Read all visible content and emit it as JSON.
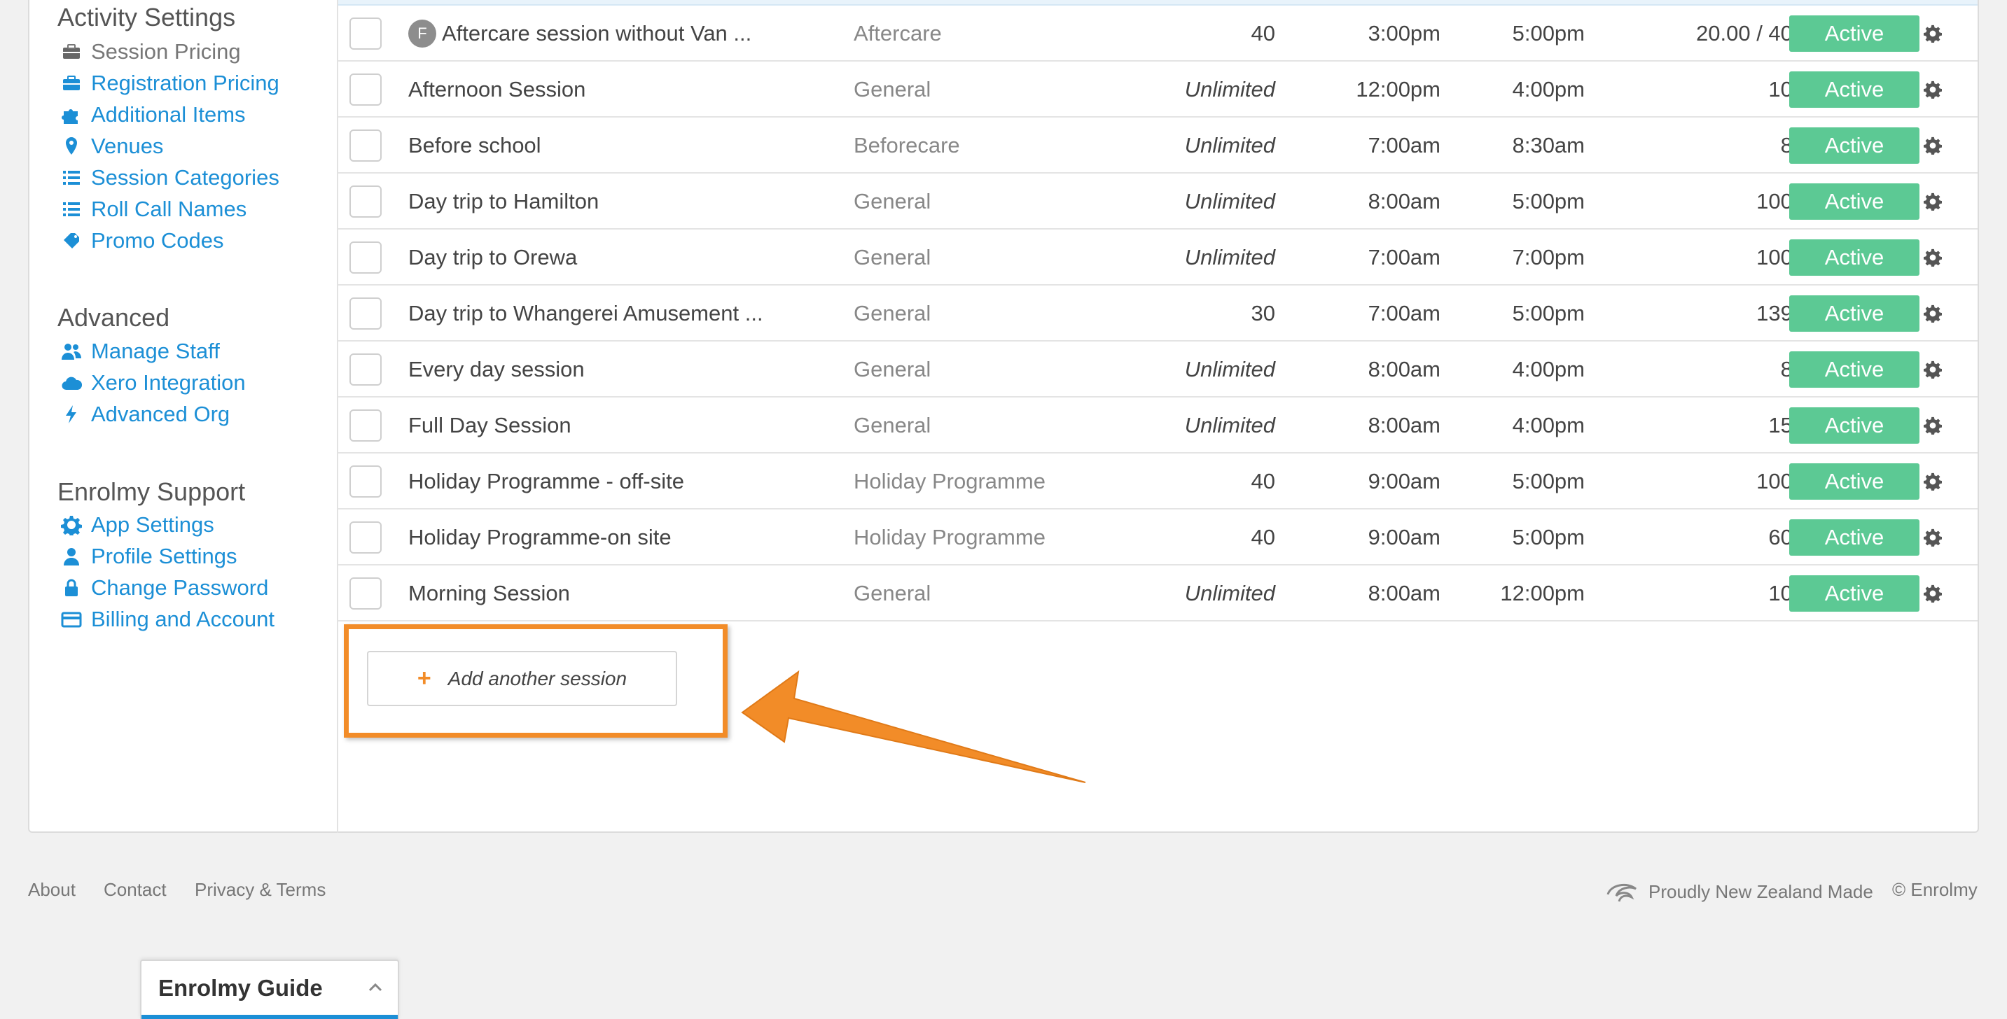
{
  "sidebar": {
    "activity_heading": "Activity Settings",
    "activity_items": [
      {
        "label": "Session Pricing",
        "icon": "briefcase-icon",
        "active": true
      },
      {
        "label": "Registration Pricing",
        "icon": "briefcase-icon"
      },
      {
        "label": "Additional Items",
        "icon": "puzzle-icon"
      },
      {
        "label": "Venues",
        "icon": "map-marker-icon"
      },
      {
        "label": "Session Categories",
        "icon": "list-icon"
      },
      {
        "label": "Roll Call Names",
        "icon": "list-icon"
      },
      {
        "label": "Promo Codes",
        "icon": "ticket-icon"
      }
    ],
    "advanced_heading": "Advanced",
    "advanced_items": [
      {
        "label": "Manage Staff",
        "icon": "users-icon"
      },
      {
        "label": "Xero Integration",
        "icon": "cloud-icon"
      },
      {
        "label": "Advanced Org",
        "icon": "bolt-icon"
      }
    ],
    "support_heading": "Enrolmy Support",
    "support_items": [
      {
        "label": "App Settings",
        "icon": "gear-icon"
      },
      {
        "label": "Profile Settings",
        "icon": "user-icon"
      },
      {
        "label": "Change Password",
        "icon": "lock-icon"
      },
      {
        "label": "Billing and Account",
        "icon": "credit-card-icon"
      }
    ]
  },
  "sessions": [
    {
      "flag": "F",
      "name": "Aftercare session without Van ...",
      "category": "Aftercare",
      "capacity": "40",
      "start": "3:00pm",
      "end": "5:00pm",
      "price": "20.00  / 40.00",
      "status": "Active"
    },
    {
      "flag": "",
      "name": "Afternoon Session",
      "category": "General",
      "capacity": "Unlimited",
      "start": "12:00pm",
      "end": "4:00pm",
      "price": "10.00",
      "status": "Active"
    },
    {
      "flag": "",
      "name": "Before school",
      "category": "Beforecare",
      "capacity": "Unlimited",
      "start": "7:00am",
      "end": "8:30am",
      "price": "8.00",
      "status": "Active"
    },
    {
      "flag": "",
      "name": "Day trip to Hamilton",
      "category": "General",
      "capacity": "Unlimited",
      "start": "8:00am",
      "end": "5:00pm",
      "price": "100.00",
      "status": "Active"
    },
    {
      "flag": "",
      "name": "Day trip to Orewa",
      "category": "General",
      "capacity": "Unlimited",
      "start": "7:00am",
      "end": "7:00pm",
      "price": "100.00",
      "status": "Active"
    },
    {
      "flag": "",
      "name": "Day trip to Whangerei Amusement ...",
      "category": "General",
      "capacity": "30",
      "start": "7:00am",
      "end": "5:00pm",
      "price": "139.00",
      "status": "Active"
    },
    {
      "flag": "",
      "name": "Every day session",
      "category": "General",
      "capacity": "Unlimited",
      "start": "8:00am",
      "end": "4:00pm",
      "price": "8.00",
      "status": "Active"
    },
    {
      "flag": "",
      "name": "Full Day Session",
      "category": "General",
      "capacity": "Unlimited",
      "start": "8:00am",
      "end": "4:00pm",
      "price": "15.00",
      "status": "Active"
    },
    {
      "flag": "",
      "name": "Holiday Programme - off-site",
      "category": "Holiday Programme",
      "capacity": "40",
      "start": "9:00am",
      "end": "5:00pm",
      "price": "100.00",
      "status": "Active"
    },
    {
      "flag": "",
      "name": "Holiday Programme-on site",
      "category": "Holiday Programme",
      "capacity": "40",
      "start": "9:00am",
      "end": "5:00pm",
      "price": "60.00",
      "status": "Active"
    },
    {
      "flag": "",
      "name": "Morning Session",
      "category": "General",
      "capacity": "Unlimited",
      "start": "8:00am",
      "end": "12:00pm",
      "price": "10.00",
      "status": "Active"
    }
  ],
  "add_button": {
    "label": "Add another session",
    "icon": "plus-icon"
  },
  "annotation": {
    "color": "#f28c28"
  },
  "footer": {
    "about": "About",
    "contact": "Contact",
    "privacy": "Privacy & Terms",
    "nz_made": "Proudly New Zealand Made",
    "copyright": "© Enrolmy"
  },
  "guide": {
    "title": "Enrolmy Guide"
  },
  "colors": {
    "link": "#1c8fd6",
    "status_active": "#5cc994",
    "highlight": "#f28c28"
  }
}
